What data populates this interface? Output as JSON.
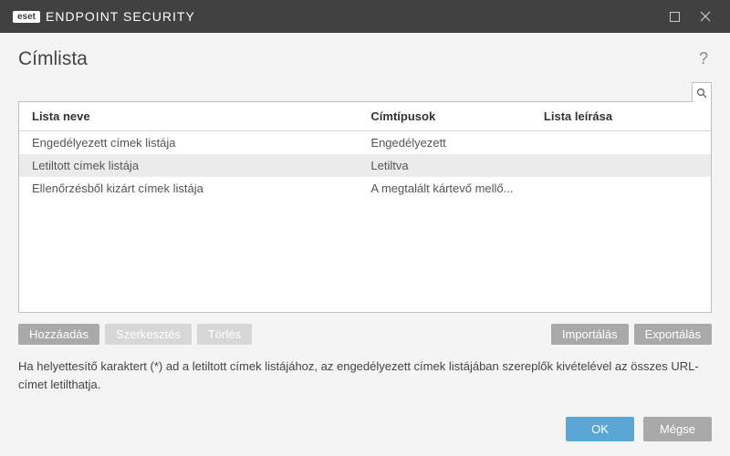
{
  "titlebar": {
    "brand_badge": "eset",
    "brand_text": "ENDPOINT SECURITY"
  },
  "header": {
    "title": "Címlista"
  },
  "table": {
    "columns": {
      "name": "Lista neve",
      "types": "Címtípusok",
      "desc": "Lista leírása"
    },
    "rows": [
      {
        "name": "Engedélyezett címek listája",
        "types": "Engedélyezett",
        "desc": ""
      },
      {
        "name": "Letiltott címek listája",
        "types": "Letiltva",
        "desc": ""
      },
      {
        "name": "Ellenőrzésből kizárt címek listája",
        "types": "A megtalált kártevő mellő...",
        "desc": ""
      }
    ]
  },
  "actions": {
    "add": "Hozzáadás",
    "edit": "Szerkesztés",
    "delete": "Törlés",
    "import": "Importálás",
    "export": "Exportálás"
  },
  "note": "Ha helyettesítő karaktert (*) ad a letiltott címek listájához, az engedélyezett címek listájában szereplők kivételével az összes URL-címet letilthatja.",
  "footer": {
    "ok": "OK",
    "cancel": "Mégse"
  }
}
